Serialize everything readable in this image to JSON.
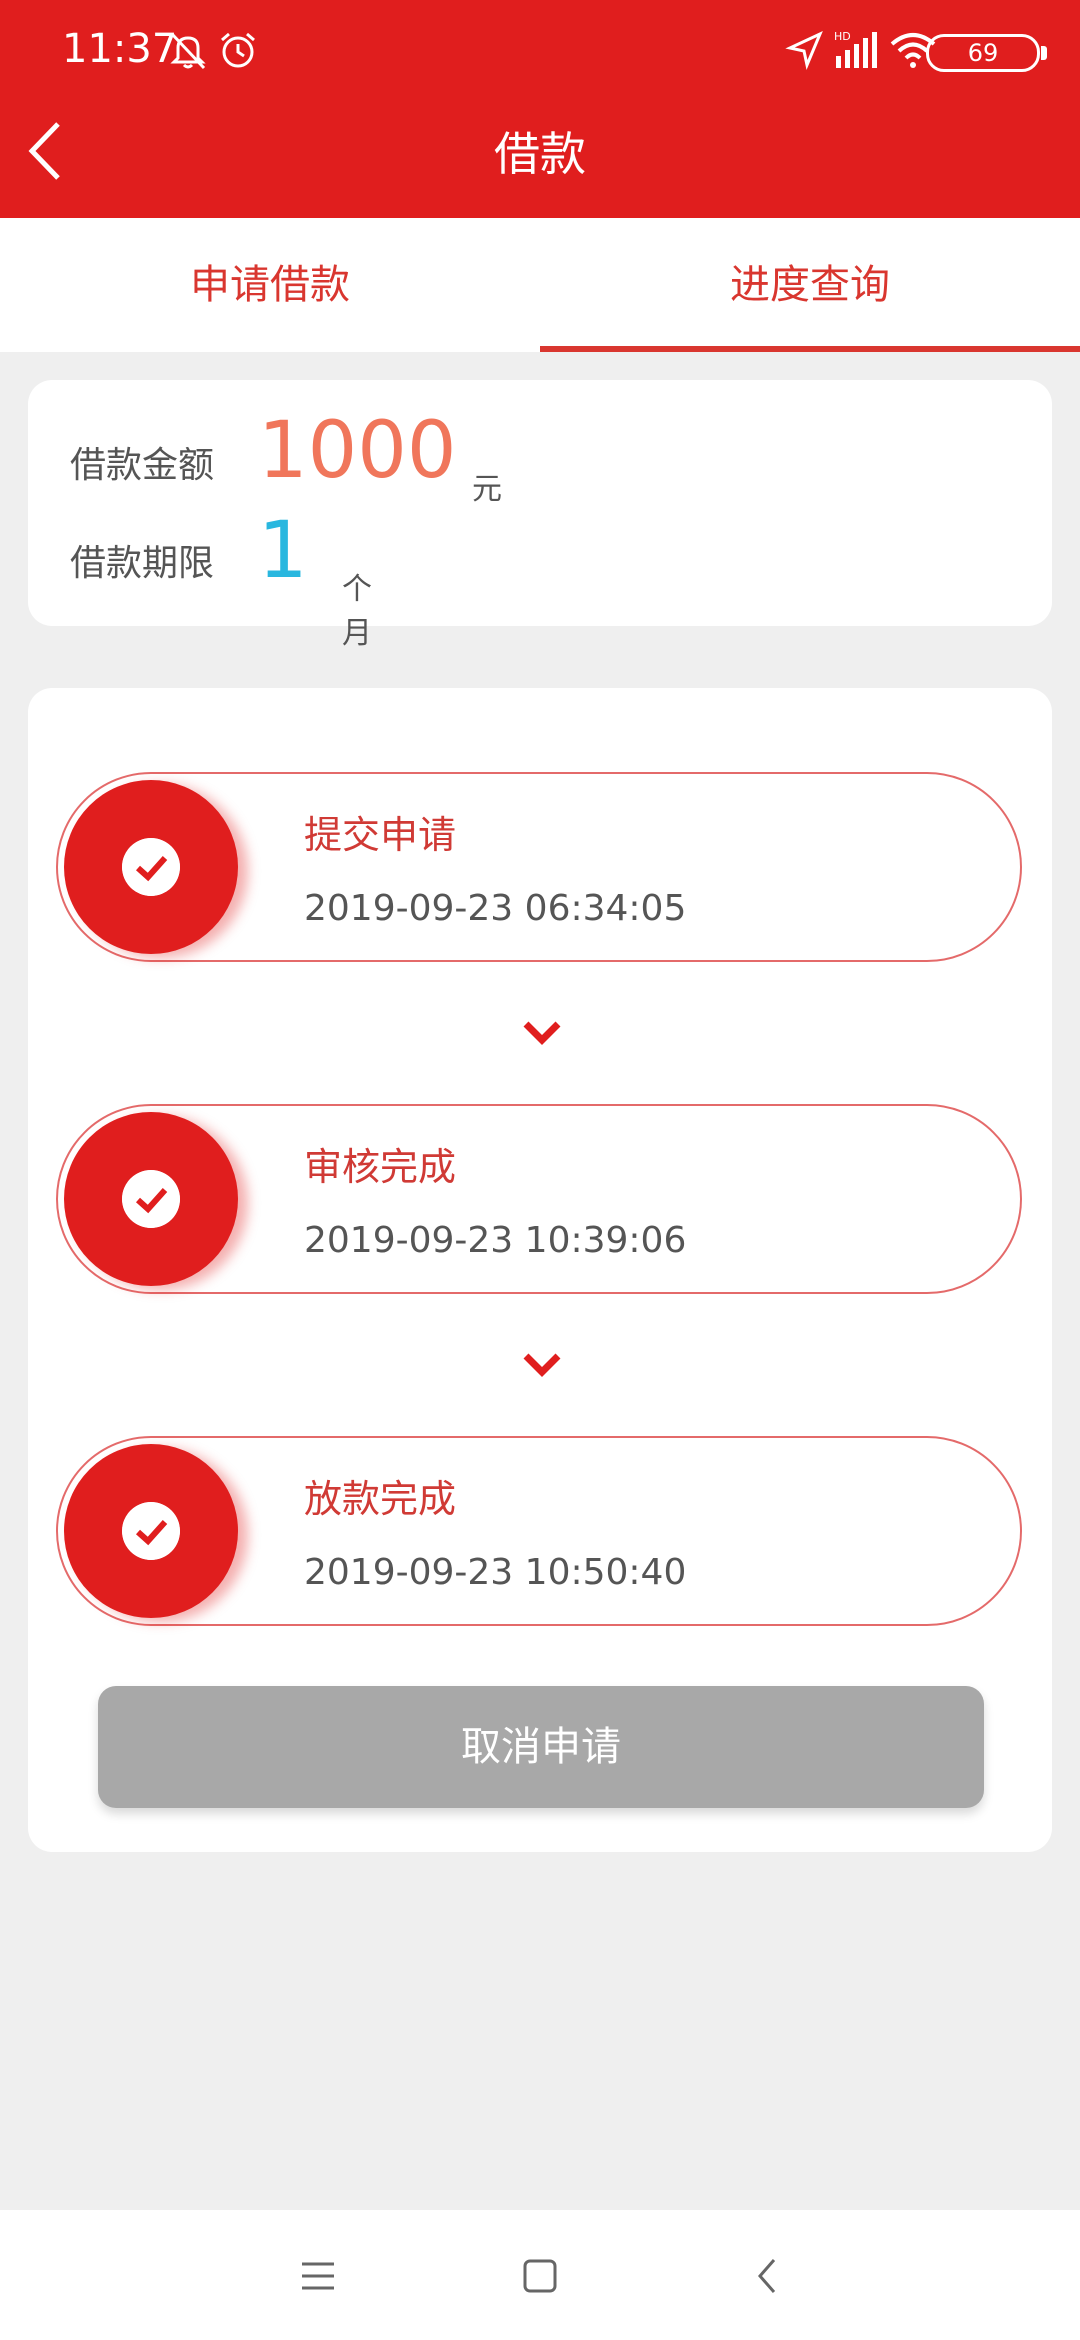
{
  "status_bar": {
    "time": "11:37",
    "battery": "69"
  },
  "header": {
    "title": "借款"
  },
  "tabs": [
    {
      "label": "申请借款",
      "active": false
    },
    {
      "label": "进度查询",
      "active": true
    }
  ],
  "loan": {
    "amount_label": "借款金额",
    "amount_value": "1000",
    "amount_unit": "元",
    "term_label": "借款期限",
    "term_value": "1",
    "term_unit": "个月"
  },
  "progress": {
    "steps": [
      {
        "title": "提交申请",
        "time": "2019-09-23 06:34:05"
      },
      {
        "title": "审核完成",
        "time": "2019-09-23 10:39:06"
      },
      {
        "title": "放款完成",
        "time": "2019-09-23 10:50:40"
      }
    ],
    "cancel_label": "取消申请"
  },
  "colors": {
    "brand_red": "#e01e1e",
    "amount": "#f0765b",
    "term": "#29b7df",
    "disabled_button": "#a8a8a8"
  },
  "icons": [
    "bell-off-icon",
    "alarm-icon",
    "location-icon",
    "signal-icon",
    "wifi-icon",
    "battery-icon",
    "back-icon",
    "check-icon",
    "chevron-down-icon",
    "menu-icon",
    "home-icon",
    "nav-back-icon"
  ]
}
